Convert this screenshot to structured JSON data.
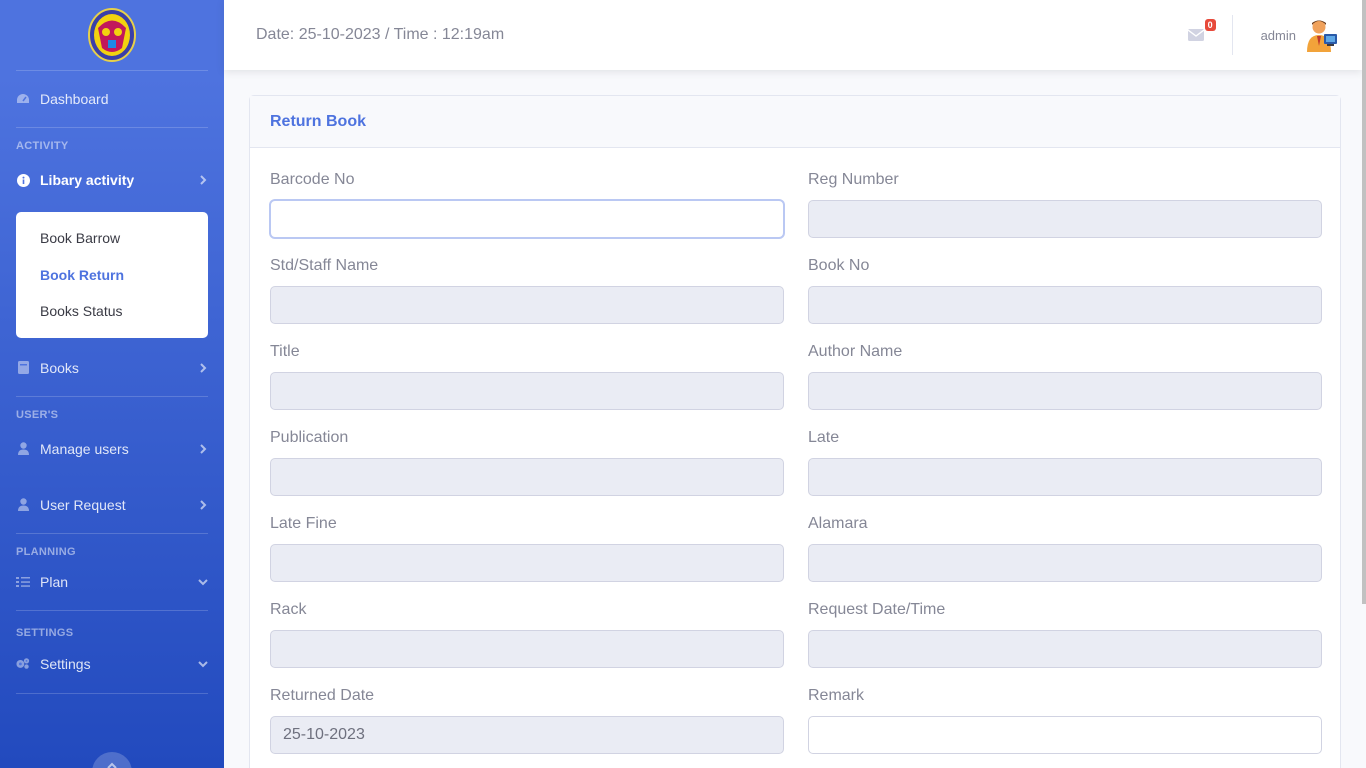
{
  "sidebar": {
    "dashboard": "Dashboard",
    "heading_activity": "ACTIVITY",
    "libary_activity": "Libary activity",
    "sub_items": [
      "Book Barrow",
      "Book Return",
      "Books Status"
    ],
    "books": "Books",
    "heading_users": "USER'S",
    "manage_users": "Manage users",
    "user_request": "User Request",
    "heading_planning": "PLANNING",
    "plan": "Plan",
    "heading_settings": "SETTINGS",
    "settings": "Settings"
  },
  "topbar": {
    "datetime": "Date: 25-10-2023 / Time : 12:19am",
    "message_count": "0",
    "user_name": "admin"
  },
  "card": {
    "title": "Return Book"
  },
  "form": {
    "fields": [
      {
        "label": "Barcode No",
        "value": ""
      },
      {
        "label": "Reg Number",
        "value": ""
      },
      {
        "label": "Std/Staff Name",
        "value": ""
      },
      {
        "label": "Book No",
        "value": ""
      },
      {
        "label": "Title",
        "value": ""
      },
      {
        "label": "Author Name",
        "value": ""
      },
      {
        "label": "Publication",
        "value": ""
      },
      {
        "label": "Late",
        "value": ""
      },
      {
        "label": "Late Fine",
        "value": ""
      },
      {
        "label": "Alamara",
        "value": ""
      },
      {
        "label": "Rack",
        "value": ""
      },
      {
        "label": "Request Date/Time",
        "value": ""
      },
      {
        "label": "Returned Date",
        "value": "25-10-2023"
      },
      {
        "label": "Remark",
        "value": ""
      }
    ]
  },
  "colors": {
    "primary": "#4e73df",
    "badge": "#e74a3b"
  }
}
